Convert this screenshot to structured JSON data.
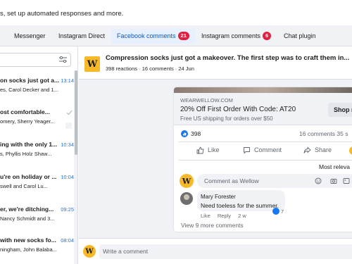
{
  "header": {
    "message": "s, set up automated responses and more."
  },
  "tabs": [
    {
      "label": "Messenger"
    },
    {
      "label": "Instagram Direct"
    },
    {
      "label": "Facebook comments",
      "badge": "21"
    },
    {
      "label": "Instagram comments",
      "badge": "6"
    },
    {
      "label": "Chat plugin"
    }
  ],
  "sidebar": {
    "conversations": [
      {
        "title": "on socks just got a...",
        "snippet": "es, Carol Decker and 1...",
        "time": "13:14"
      },
      {
        "title": "ost comfortable...",
        "snippet": "omery, Sherry Yeager...",
        "time": ""
      },
      {
        "title": "ing with the only 1...",
        "snippet": "s, Phyllis Holz Shaw...",
        "time": "10:34"
      },
      {
        "title": "u're on holiday or ...",
        "snippet": "swell and Carol Lu...",
        "time": "10:04"
      },
      {
        "title": "er, we're ditching...",
        "snippet": "Nancy Schmidt and 3...",
        "time": "09:25"
      },
      {
        "title": "with new socks fo...",
        "snippet": "ningham, John Balaba...",
        "time": "08:04"
      }
    ]
  },
  "post": {
    "logo_letter": "W",
    "title": "Compression socks just got a makeover. The first step was to craft them in...",
    "meta": "398 reactions · 16 comments · 24 Jun",
    "ad": {
      "domain": "WEARWELLOW.COM",
      "title": "20% Off First Order With Code: AT20",
      "description": "Free US shipping for orders over $50",
      "cta": "Shop n"
    },
    "reactions_count": "398",
    "comment_stats": "16 comments  35 s",
    "actions": {
      "like": "Like",
      "comment": "Comment",
      "share": "Share"
    },
    "sort_label": "Most releva",
    "comment_placeholder": "Comment as Wellow",
    "comments": [
      {
        "author": "Mary Forester",
        "text": "Need toeless for the summer.",
        "like_label": "Like",
        "reply_label": "Reply",
        "age": "2 w",
        "likes": "7"
      }
    ],
    "view_more": "View 9 more comments"
  },
  "composer": {
    "placeholder": "Write a comment"
  },
  "colors": {
    "accent": "#1877f2",
    "brand": "#f7b928",
    "badge": "#e41e3f",
    "active_tab_bg": "#e7f0fd"
  },
  "icons": [
    "filter-icon",
    "check-icon",
    "like-icon",
    "comment-icon",
    "share-icon",
    "emoji-icon",
    "camera-icon",
    "gif-icon"
  ]
}
